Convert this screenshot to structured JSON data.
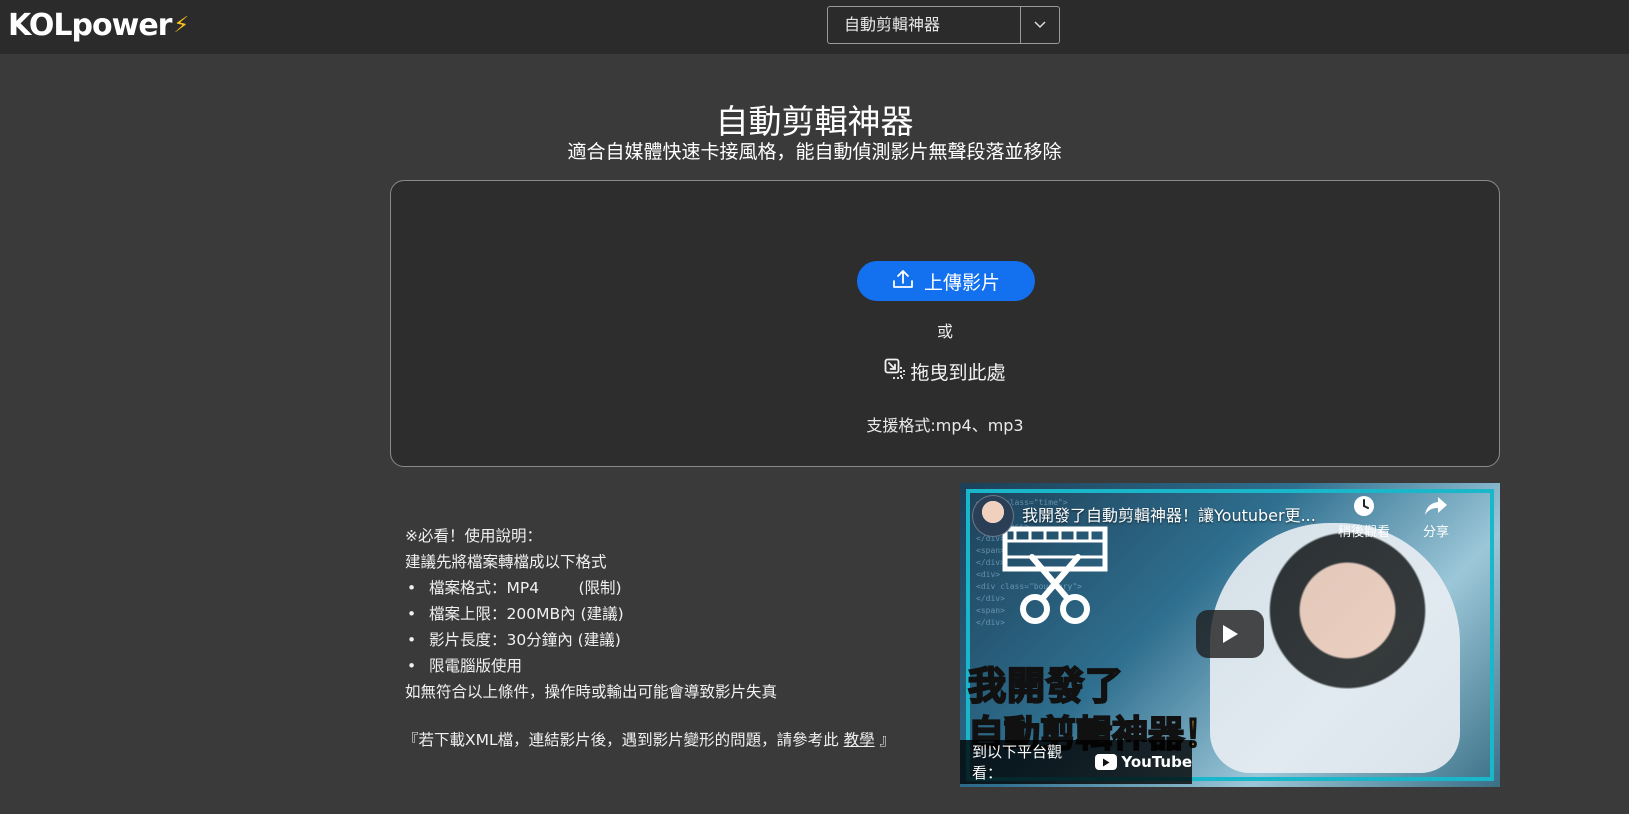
{
  "header": {
    "logo_text": "KOLpower",
    "tool_select": {
      "selected": "自動剪輯神器"
    }
  },
  "main": {
    "title": "自動剪輯神器",
    "subtitle": "適合自媒體快速卡接風格，能自動偵測影片無聲段落並移除"
  },
  "upload": {
    "button_label": "上傳影片",
    "or_text": "或",
    "drag_label": "拖曳到此處",
    "formats_text": "支援格式:mp4、mp3"
  },
  "instructions": {
    "heading": "※必看！使用說明：",
    "intro": "建議先將檔案轉檔成以下格式",
    "items": [
      "檔案格式：MP4        (限制)",
      "檔案上限：200MB內 (建議)",
      "影片長度：30分鐘內 (建議)",
      "限電腦版使用"
    ],
    "warning": "如無符合以上條件，操作時或輸出可能會導致影片失真",
    "xml_note_prefix": "『若下載XML檔，連結影片後，遇到影片變形的問題，請參考此",
    "xml_note_link": "教學",
    "xml_note_suffix": "』"
  },
  "video": {
    "title": "我開發了自動剪輯神器！讓Youtuber更...",
    "watch_later_label": "稍後觀看",
    "share_label": "分享",
    "watch_on_label": "到以下平台觀看：",
    "youtube_label": "YouTube",
    "thumbnail_text_line1": "我開發了",
    "thumbnail_text_line2": "自動剪輯神器！"
  },
  "colors": {
    "accent": "#1371f0",
    "header_bg": "#2b2b2b",
    "page_bg": "#3a3a3a",
    "dropzone_bg": "#2d2d2d",
    "logo_bolt": "#f7c21a"
  }
}
